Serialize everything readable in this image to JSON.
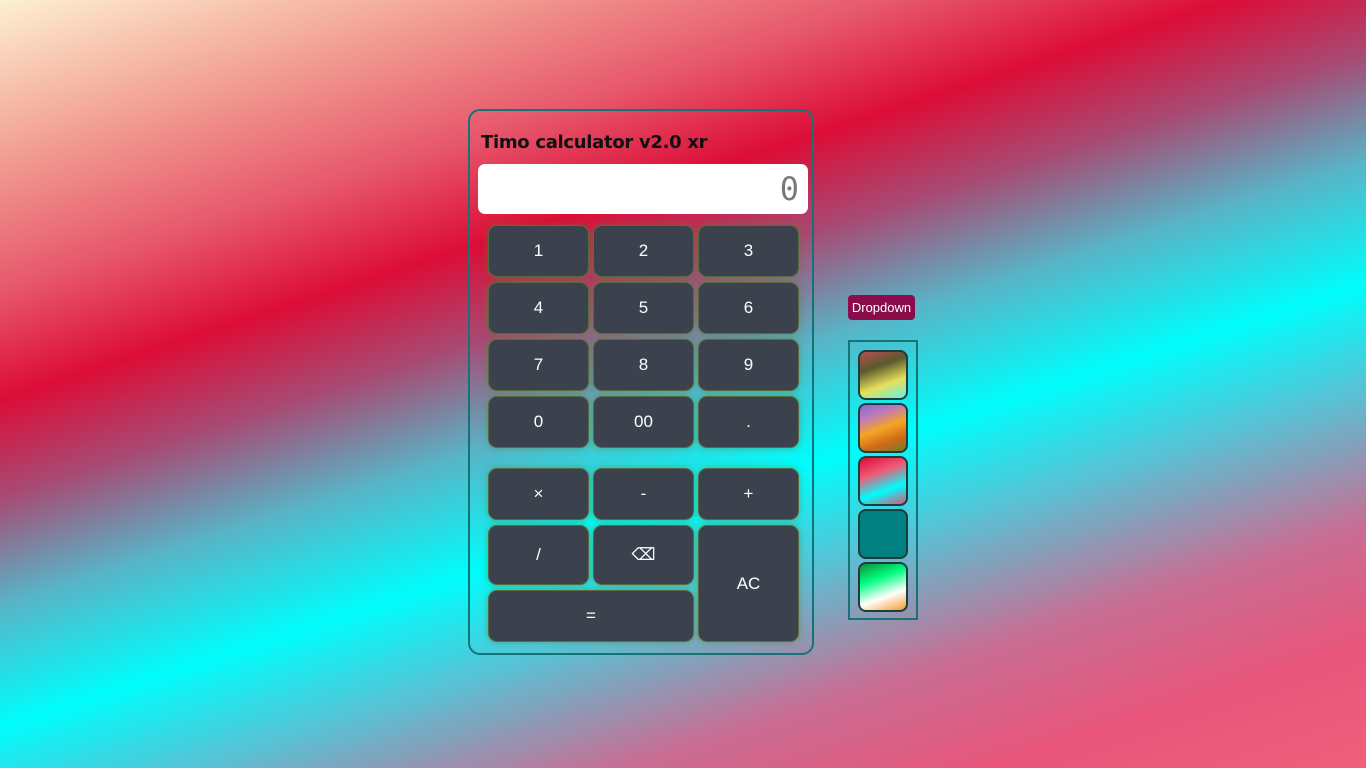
{
  "calculator": {
    "title": "Timo calculator v2.0 xr",
    "display_value": "0",
    "keys": {
      "k1": "1",
      "k2": "2",
      "k3": "3",
      "k4": "4",
      "k5": "5",
      "k6": "6",
      "k7": "7",
      "k8": "8",
      "k9": "9",
      "k0": "0",
      "k00": "00",
      "dot": ".",
      "multiply": "×",
      "minus": "-",
      "plus": "+",
      "divide": "/",
      "backspace": "⌫",
      "clear": "AC",
      "equals": "="
    }
  },
  "theme_picker": {
    "dropdown_label": "Dropdown",
    "swatches": [
      {
        "name": "olive-yellow-cyan",
        "colors": [
          "#b44f4f",
          "#5a5a2e",
          "#e6e05c",
          "#5ff3e6"
        ]
      },
      {
        "name": "purple-orange",
        "colors": [
          "#8a6ad8",
          "#c07ab8",
          "#f5a623",
          "#d06a18",
          "#6e7f2c"
        ]
      },
      {
        "name": "red-cyan",
        "colors": [
          "#dc0d37",
          "#f05a78",
          "#00fdfc",
          "#e0557a"
        ]
      },
      {
        "name": "teal",
        "colors": [
          "#008080"
        ]
      },
      {
        "name": "green-white-orange",
        "colors": [
          "#0f8f3c",
          "#00ff80",
          "#ffffff",
          "#f29a2e"
        ]
      }
    ]
  }
}
